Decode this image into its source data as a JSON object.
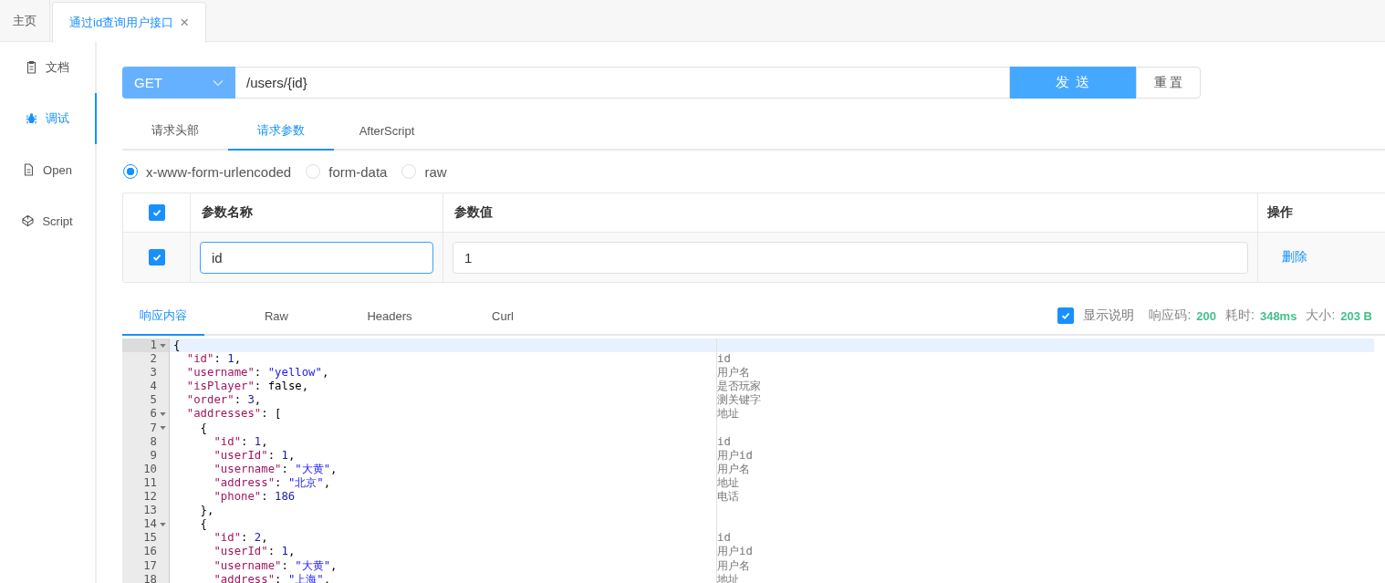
{
  "page_tabs": [
    {
      "label": "主页",
      "selected": false,
      "closable": false
    },
    {
      "label": "通过id查询用户接口",
      "selected": true,
      "closable": true,
      "close_glyph": "×"
    }
  ],
  "sidebar": {
    "items": [
      {
        "label": "文档",
        "selected": false
      },
      {
        "label": "调试",
        "selected": true
      },
      {
        "label": "Open",
        "selected": false
      },
      {
        "label": "Script",
        "selected": false
      }
    ]
  },
  "request": {
    "method": "GET",
    "url": "/users/{id}",
    "send": "发 送",
    "reset": "重 置"
  },
  "request_tabs": [
    {
      "label": "请求头部",
      "selected": false
    },
    {
      "label": "请求参数",
      "selected": true
    },
    {
      "label": "AfterScript",
      "selected": false
    }
  ],
  "body_types": [
    {
      "label": "x-www-form-urlencoded",
      "selected": true
    },
    {
      "label": "form-data",
      "selected": false
    },
    {
      "label": "raw",
      "selected": false
    }
  ],
  "params_table": {
    "all_checked": true,
    "columns": [
      "参数名称",
      "参数值",
      "操作"
    ],
    "rows": [
      {
        "checked": true,
        "name": "id",
        "value": "1",
        "action": "删除"
      }
    ]
  },
  "response_tabs": [
    {
      "label": "响应内容",
      "selected": true
    },
    {
      "label": "Raw",
      "selected": false
    },
    {
      "label": "Headers",
      "selected": false
    },
    {
      "label": "Curl",
      "selected": false
    }
  ],
  "show_notes": {
    "label": "显示说明",
    "checked": true
  },
  "stats": [
    {
      "label": "响应码:",
      "value": "200"
    },
    {
      "label": "耗时:",
      "value": "348ms"
    },
    {
      "label": "大小:",
      "value": "203 B"
    }
  ],
  "editor": {
    "lines": [
      {
        "number": "1",
        "fold": true,
        "active": true,
        "text": "{"
      },
      {
        "number": "2",
        "fold": false,
        "active": false,
        "text": "  \"id\": 1,",
        "note": "id"
      },
      {
        "number": "3",
        "fold": false,
        "active": false,
        "text": "  \"username\": \"yellow\",",
        "note": "用户名"
      },
      {
        "number": "4",
        "fold": false,
        "active": false,
        "text": "  \"isPlayer\": false,",
        "note": "是否玩家"
      },
      {
        "number": "5",
        "fold": false,
        "active": false,
        "text": "  \"order\": 3,",
        "note": "测关键字"
      },
      {
        "number": "6",
        "fold": true,
        "active": false,
        "text": "  \"addresses\": [",
        "note": "地址"
      },
      {
        "number": "7",
        "fold": true,
        "active": false,
        "text": "    {"
      },
      {
        "number": "8",
        "fold": false,
        "active": false,
        "text": "      \"id\": 1,",
        "note": "id"
      },
      {
        "number": "9",
        "fold": false,
        "active": false,
        "text": "      \"userId\": 1,",
        "note": "用户id"
      },
      {
        "number": "10",
        "fold": false,
        "active": false,
        "text": "      \"username\": \"大黄\",",
        "note": "用户名"
      },
      {
        "number": "11",
        "fold": false,
        "active": false,
        "text": "      \"address\": \"北京\",",
        "note": "地址"
      },
      {
        "number": "12",
        "fold": false,
        "active": false,
        "text": "      \"phone\": 186",
        "note": "电话"
      },
      {
        "number": "13",
        "fold": false,
        "active": false,
        "text": "    },"
      },
      {
        "number": "14",
        "fold": true,
        "active": false,
        "text": "    {"
      },
      {
        "number": "15",
        "fold": false,
        "active": false,
        "text": "      \"id\": 2,",
        "note": "id"
      },
      {
        "number": "16",
        "fold": false,
        "active": false,
        "text": "      \"userId\": 1,",
        "note": "用户id"
      },
      {
        "number": "17",
        "fold": false,
        "active": false,
        "text": "      \"username\": \"大黄\",",
        "note": "用户名"
      },
      {
        "number": "18",
        "fold": false,
        "active": false,
        "text": "      \"address\": \"上海\",",
        "note": "地址"
      }
    ]
  }
}
